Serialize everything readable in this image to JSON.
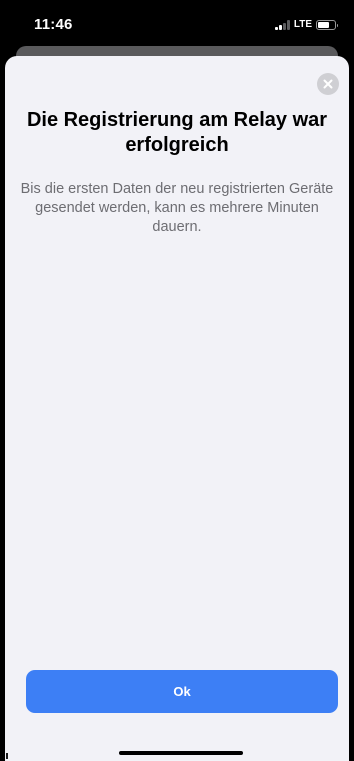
{
  "status_bar": {
    "time": "11:46",
    "network": "LTE",
    "signal_bars_active": 2,
    "signal_bars_total": 4,
    "battery_level": 0.7
  },
  "sheet": {
    "title": "Die Registrierung am Relay war erfolgreich",
    "message": "Bis die ersten Daten der neu registrierten Geräte gesendet werden, kann es mehrere Minuten dauern.",
    "close_icon": "close-icon",
    "ok_label": "Ok"
  },
  "colors": {
    "sheet_background": "#f2f2f7",
    "accent": "#3d7ff5",
    "message_text": "#6d6d72",
    "close_button": "#cfcfd3"
  }
}
